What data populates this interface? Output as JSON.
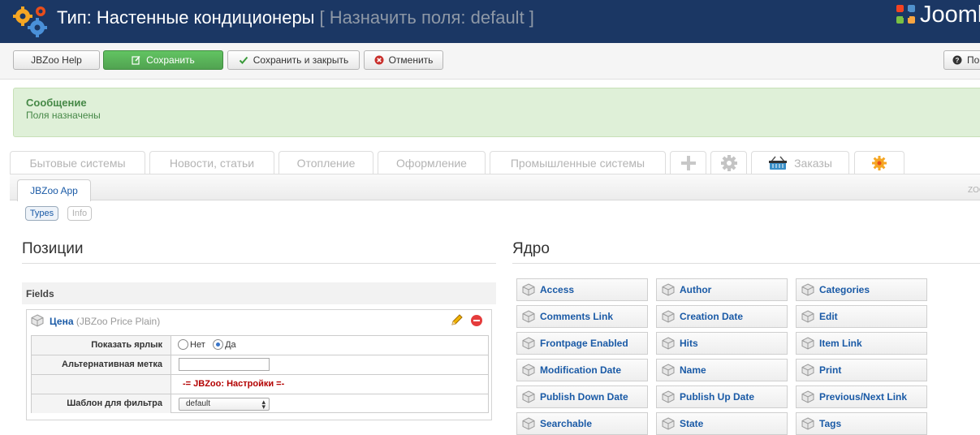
{
  "header": {
    "title": "Тип: Настенные кондиционеры",
    "subtitle": "[ Назначить поля: default ]",
    "brand": "Joomla!"
  },
  "toolbar": {
    "help": "JBZoo Help",
    "save": "Сохранить",
    "save_close": "Сохранить и закрыть",
    "cancel": "Отменить",
    "right_btn": "По"
  },
  "message": {
    "heading": "Сообщение",
    "text": "Поля назначены"
  },
  "tabs": [
    "Бытовые системы",
    "Новости, статьи",
    "Отопление",
    "Оформление",
    "Промышленные системы",
    "Заказы"
  ],
  "subbar": {
    "app_tab": "JBZoo App",
    "zoo_label": "ZOO"
  },
  "pills": {
    "types": "Types",
    "info": "Info"
  },
  "positions": {
    "heading": "Позиции",
    "fields_heading": "Fields",
    "field": {
      "name": "Цена",
      "type": "(JBZoo Price Plain)",
      "rows": {
        "show_label": "Показать ярлык",
        "radio_no": "Нет",
        "radio_yes": "Да",
        "alt_label": "Альтернативная метка",
        "settings_note": "-= JBZoo: Настройки =-",
        "filter_template": "Шаблон для фильтра",
        "filter_value": "default"
      }
    }
  },
  "core": {
    "heading": "Ядро",
    "items": [
      "Access",
      "Author",
      "Categories",
      "Comments Link",
      "Creation Date",
      "Edit",
      "Frontpage Enabled",
      "Hits",
      "Item Link",
      "Modification Date",
      "Name",
      "Print",
      "Publish Down Date",
      "Publish Up Date",
      "Previous/Next Link",
      "Searchable",
      "State",
      "Tags"
    ]
  },
  "colors": {
    "header_bg": "#1b3764",
    "save_green": "#5bb75b",
    "message_bg": "#dff0d8",
    "link_blue": "#1a5aa6"
  }
}
